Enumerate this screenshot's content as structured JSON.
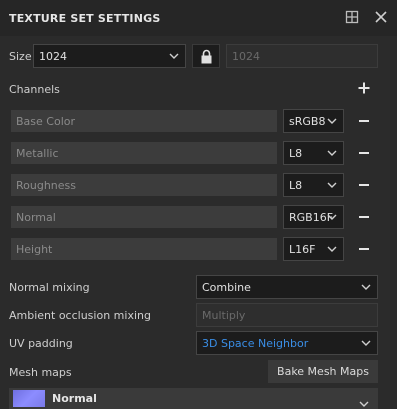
{
  "panel": {
    "title": "TEXTURE SET SETTINGS",
    "size_label": "Size",
    "size_value": "1024",
    "size_linked_value": "1024",
    "channels_label": "Channels",
    "channels": [
      {
        "name": "Base Color",
        "format": "sRGB8"
      },
      {
        "name": "Metallic",
        "format": "L8"
      },
      {
        "name": "Roughness",
        "format": "L8"
      },
      {
        "name": "Normal",
        "format": "RGB16F"
      },
      {
        "name": "Height",
        "format": "L16F"
      }
    ],
    "normal_mixing_label": "Normal mixing",
    "normal_mixing_value": "Combine",
    "ao_mixing_label": "Ambient occlusion mixing",
    "ao_mixing_value": "Multiply",
    "uv_padding_label": "UV padding",
    "uv_padding_value": "3D Space Neighbor",
    "mesh_maps_label": "Mesh maps",
    "bake_button": "Bake Mesh Maps",
    "mesh_map_item": "Normal"
  },
  "colors": {
    "accent_blue": "#3a8ee6",
    "background": "#2b2b2b"
  }
}
